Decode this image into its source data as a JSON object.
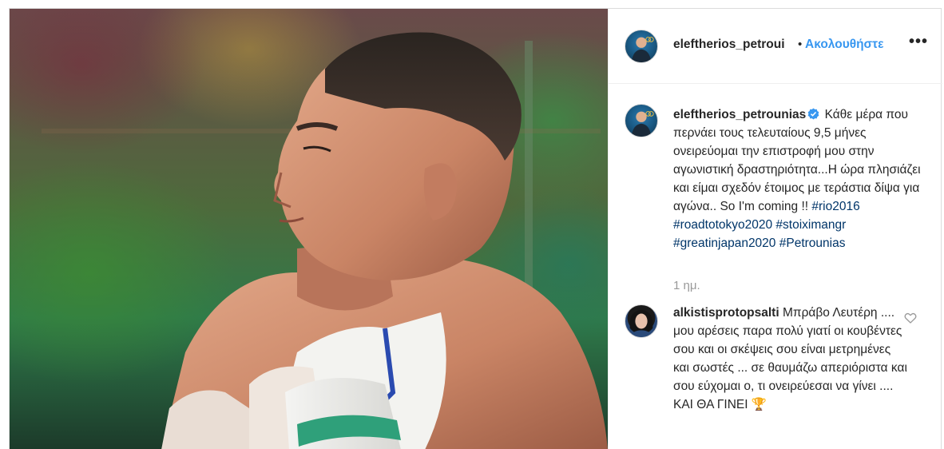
{
  "post": {
    "username": "eleftherios_petroui",
    "follow_label": "Ακολουθήστε",
    "separator": "•",
    "more_label": "•••"
  },
  "caption": {
    "username": "eleftherios_petrounias",
    "verified": true,
    "text": "Κάθε μέρα που περνάει τους τελευταίους 9,5 μήνες ονειρεύομαι την επιστροφή μου στην αγωνιστική δραστηριότητα...Η ώρα πλησιάζει και είμαι σχεδόν έτοιμος με τεράστια δίψα για αγώνα.. So I'm coming !! ",
    "hashtags": [
      "#rio2016",
      "#roadtotokyo2020",
      "#stoiximangr",
      "#greatinjapan2020",
      "#Petrounias"
    ],
    "time": "1 ημ."
  },
  "comments": [
    {
      "username": "alkistisprotopsalti",
      "text": "Μπράβο Λευτέρη .... μου αρέσεις παρα πολύ γιατί οι κουβέντες σου και οι σκέψεις σου είναι μετρημένες και σωστές ... σε θαυμάζω απεριόριστα και σου εύχομαι ο, τι ονειρεύεσαι να γίνει .... ΚΑΙ ΘΑ ΓΙΝΕΙ 🏆"
    }
  ],
  "icons": {
    "verified": "verified-badge-icon",
    "like": "heart-icon",
    "more": "more-options-icon"
  },
  "colors": {
    "link": "#3897f0",
    "hashtag": "#003569",
    "muted": "#999999",
    "text": "#262626",
    "border": "#dbdbdb"
  }
}
